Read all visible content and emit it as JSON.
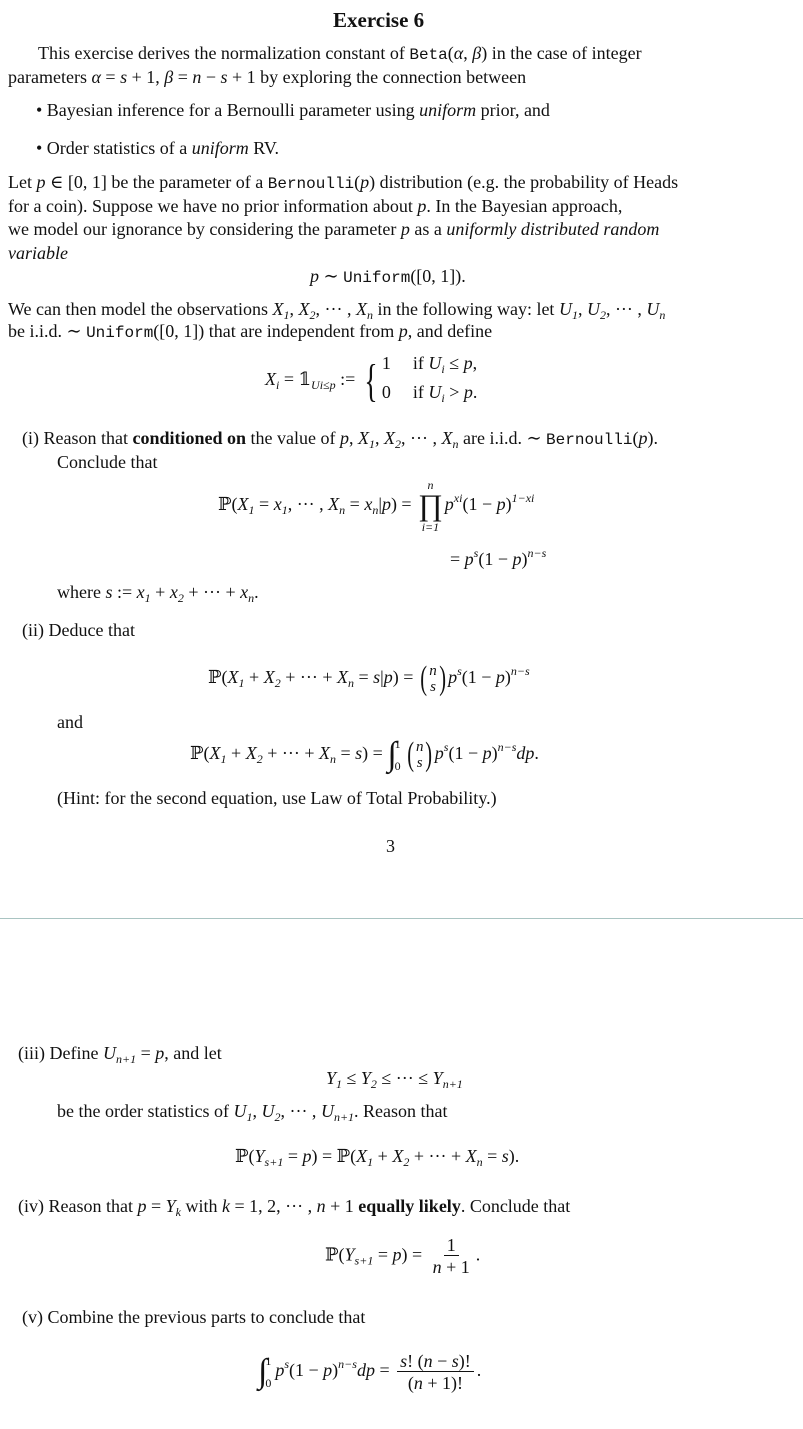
{
  "title": [
    [
      "b",
      "Exercise 6"
    ]
  ],
  "intro1": [
    [
      "t",
      "This exercise derives the normalization constant of "
    ],
    [
      "m",
      "Beta"
    ],
    [
      "t",
      "("
    ],
    [
      "i",
      "α"
    ],
    [
      "t",
      ", "
    ],
    [
      "i",
      "β"
    ],
    [
      "t",
      ") in the case of integer"
    ]
  ],
  "intro2": [
    [
      "t",
      "parameters "
    ],
    [
      "i",
      "α"
    ],
    [
      "t",
      " = "
    ],
    [
      "i",
      "s"
    ],
    [
      "t",
      " + 1, "
    ],
    [
      "i",
      "β"
    ],
    [
      "t",
      " = "
    ],
    [
      "i",
      "n"
    ],
    [
      "t",
      " − "
    ],
    [
      "i",
      "s"
    ],
    [
      "t",
      " + 1 by exploring the connection between"
    ]
  ],
  "bullet1": [
    [
      "t",
      "•  Bayesian inference for a Bernoulli parameter using "
    ],
    [
      "i",
      "uniform"
    ],
    [
      "t",
      " prior, and"
    ]
  ],
  "bullet2": [
    [
      "t",
      "•  Order statistics of a "
    ],
    [
      "i",
      "uniform"
    ],
    [
      "t",
      " RV."
    ]
  ],
  "p1": [
    [
      "t",
      "Let "
    ],
    [
      "i",
      "p"
    ],
    [
      "t",
      " ∈ [0, 1] be the parameter of a "
    ],
    [
      "m",
      "Bernoulli"
    ],
    [
      "t",
      "("
    ],
    [
      "i",
      "p"
    ],
    [
      "t",
      ") distribution (e.g. the probability of Heads"
    ]
  ],
  "p2": [
    [
      "t",
      "for a coin).  Suppose we have no prior information about "
    ],
    [
      "i",
      "p"
    ],
    [
      "t",
      ".  In the Bayesian approach,"
    ]
  ],
  "p3": [
    [
      "t",
      "we model our ignorance by considering the parameter "
    ],
    [
      "i",
      "p"
    ],
    [
      "t",
      " as a "
    ],
    [
      "i",
      "uniformly distributed random"
    ]
  ],
  "p4": [
    [
      "i",
      "variable"
    ]
  ],
  "eq_prior": [
    [
      "i",
      "p"
    ],
    [
      "t",
      " ∼ "
    ],
    [
      "m",
      "Uniform"
    ],
    [
      "t",
      "([0, 1])."
    ]
  ],
  "p5": [
    [
      "t",
      "We can then model the observations "
    ],
    [
      "i",
      "X"
    ],
    [
      "sub",
      "1"
    ],
    [
      "t",
      ", "
    ],
    [
      "i",
      "X"
    ],
    [
      "sub",
      "2"
    ],
    [
      "t",
      ", ··· , "
    ],
    [
      "i",
      "X"
    ],
    [
      "sub",
      "n"
    ],
    [
      "t",
      " in the following way: let "
    ],
    [
      "i",
      "U"
    ],
    [
      "sub",
      "1"
    ],
    [
      "t",
      ", "
    ],
    [
      "i",
      "U"
    ],
    [
      "sub",
      "2"
    ],
    [
      "t",
      ", ··· , "
    ],
    [
      "i",
      "U"
    ],
    [
      "sub",
      "n"
    ]
  ],
  "p6": [
    [
      "t",
      "be i.i.d. ∼ "
    ],
    [
      "m",
      "Uniform"
    ],
    [
      "t",
      "([0, 1]) that are independent from "
    ],
    [
      "i",
      "p"
    ],
    [
      "t",
      ", and define"
    ]
  ],
  "eq_def": [
    [
      "i",
      "X"
    ],
    [
      "sub",
      "i"
    ],
    [
      "t",
      " = 𝟙"
    ],
    [
      "sub",
      "Ui≤p"
    ],
    [
      "t",
      " := "
    ],
    [
      "cases",
      [
        [
          [
            "t",
            "1"
          ],
          [
            "gap",
            ""
          ],
          [
            "t",
            "if "
          ],
          [
            "i",
            "U"
          ],
          [
            "sub",
            "i"
          ],
          [
            "t",
            " ≤ "
          ],
          [
            "i",
            "p"
          ],
          [
            "t",
            ","
          ]
        ],
        [
          [
            "t",
            "0"
          ],
          [
            "gap",
            ""
          ],
          [
            "t",
            "if "
          ],
          [
            "i",
            "U"
          ],
          [
            "sub",
            "i"
          ],
          [
            "t",
            " > "
          ],
          [
            "i",
            "p"
          ],
          [
            "t",
            "."
          ]
        ]
      ]
    ]
  ],
  "q1a": [
    [
      "t",
      "(i) Reason that "
    ],
    [
      "b",
      "conditioned on"
    ],
    [
      "t",
      " the value of "
    ],
    [
      "i",
      "p"
    ],
    [
      "t",
      ", "
    ],
    [
      "i",
      "X"
    ],
    [
      "sub",
      "1"
    ],
    [
      "t",
      ", "
    ],
    [
      "i",
      "X"
    ],
    [
      "sub",
      "2"
    ],
    [
      "t",
      ", ··· , "
    ],
    [
      "i",
      "X"
    ],
    [
      "sub",
      "n"
    ],
    [
      "t",
      " are i.i.d. ∼ "
    ],
    [
      "m",
      "Bernoulli"
    ],
    [
      "t",
      "("
    ],
    [
      "i",
      "p"
    ],
    [
      "t",
      ")."
    ]
  ],
  "q1b": [
    [
      "t",
      "Conclude that"
    ]
  ],
  "eq_joint": [
    [
      "t",
      "ℙ("
    ],
    [
      "i",
      "X"
    ],
    [
      "sub",
      "1"
    ],
    [
      "t",
      " = "
    ],
    [
      "i",
      "x"
    ],
    [
      "sub",
      "1"
    ],
    [
      "t",
      ", ··· , "
    ],
    [
      "i",
      "X"
    ],
    [
      "sub",
      "n"
    ],
    [
      "t",
      " = "
    ],
    [
      "i",
      "x"
    ],
    [
      "sub",
      "n"
    ],
    [
      "t",
      "|"
    ],
    [
      "i",
      "p"
    ],
    [
      "t",
      ") = "
    ],
    [
      "op",
      "∏",
      "n",
      "i=1"
    ],
    [
      "i",
      "p"
    ],
    [
      "sup",
      "xi"
    ],
    [
      "t",
      "(1 − "
    ],
    [
      "i",
      "p"
    ],
    [
      "t",
      ")"
    ],
    [
      "sup",
      "1−xi"
    ]
  ],
  "eq_joint2": [
    [
      "t",
      "= "
    ],
    [
      "i",
      "p"
    ],
    [
      "sup",
      "s"
    ],
    [
      "t",
      "(1 − "
    ],
    [
      "i",
      "p"
    ],
    [
      "t",
      ")"
    ],
    [
      "sup",
      "n−s"
    ]
  ],
  "q1c": [
    [
      "t",
      "where "
    ],
    [
      "i",
      "s"
    ],
    [
      "t",
      " := "
    ],
    [
      "i",
      "x"
    ],
    [
      "sub",
      "1"
    ],
    [
      "t",
      " + "
    ],
    [
      "i",
      "x"
    ],
    [
      "sub",
      "2"
    ],
    [
      "t",
      " + ··· + "
    ],
    [
      "i",
      "x"
    ],
    [
      "sub",
      "n"
    ],
    [
      "t",
      "."
    ]
  ],
  "q2a": [
    [
      "t",
      "(ii) Deduce that"
    ]
  ],
  "eq_cond": [
    [
      "t",
      "ℙ("
    ],
    [
      "i",
      "X"
    ],
    [
      "sub",
      "1"
    ],
    [
      "t",
      " + "
    ],
    [
      "i",
      "X"
    ],
    [
      "sub",
      "2"
    ],
    [
      "t",
      " + ··· + "
    ],
    [
      "i",
      "X"
    ],
    [
      "sub",
      "n"
    ],
    [
      "t",
      " = "
    ],
    [
      "i",
      "s"
    ],
    [
      "t",
      "|"
    ],
    [
      "i",
      "p"
    ],
    [
      "t",
      ") = "
    ],
    [
      "binom",
      "n",
      "s"
    ],
    [
      "i",
      "p"
    ],
    [
      "sup",
      "s"
    ],
    [
      "t",
      "(1 − "
    ],
    [
      "i",
      "p"
    ],
    [
      "t",
      ")"
    ],
    [
      "sup",
      "n−s"
    ]
  ],
  "q2b": [
    [
      "t",
      "and"
    ]
  ],
  "eq_total": [
    [
      "t",
      "ℙ("
    ],
    [
      "i",
      "X"
    ],
    [
      "sub",
      "1"
    ],
    [
      "t",
      " + "
    ],
    [
      "i",
      "X"
    ],
    [
      "sub",
      "2"
    ],
    [
      "t",
      " + ··· + "
    ],
    [
      "i",
      "X"
    ],
    [
      "sub",
      "n"
    ],
    [
      "t",
      " = "
    ],
    [
      "i",
      "s"
    ],
    [
      "t",
      ") = "
    ],
    [
      "int",
      "∫",
      "1",
      "0"
    ],
    [
      "binom",
      "n",
      "s"
    ],
    [
      "i",
      "p"
    ],
    [
      "sup",
      "s"
    ],
    [
      "t",
      "(1 − "
    ],
    [
      "i",
      "p"
    ],
    [
      "t",
      ")"
    ],
    [
      "sup",
      "n−s"
    ],
    [
      "i",
      "dp"
    ],
    [
      "t",
      "."
    ]
  ],
  "q2c": [
    [
      "t",
      "(Hint: for the second equation, use Law of Total Probability.)"
    ]
  ],
  "page_number": [
    [
      "t",
      "3"
    ]
  ],
  "q3a": [
    [
      "t",
      "(iii) Define "
    ],
    [
      "i",
      "U"
    ],
    [
      "sub",
      "n+1"
    ],
    [
      "t",
      " = "
    ],
    [
      "i",
      "p"
    ],
    [
      "t",
      ", and let"
    ]
  ],
  "eq_order": [
    [
      "i",
      "Y"
    ],
    [
      "sub",
      "1"
    ],
    [
      "t",
      " ≤ "
    ],
    [
      "i",
      "Y"
    ],
    [
      "sub",
      "2"
    ],
    [
      "t",
      " ≤ ··· ≤ "
    ],
    [
      "i",
      "Y"
    ],
    [
      "sub",
      "n+1"
    ]
  ],
  "q3b": [
    [
      "t",
      "be the order statistics of "
    ],
    [
      "i",
      "U"
    ],
    [
      "sub",
      "1"
    ],
    [
      "t",
      ", "
    ],
    [
      "i",
      "U"
    ],
    [
      "sub",
      "2"
    ],
    [
      "t",
      ", ··· , "
    ],
    [
      "i",
      "U"
    ],
    [
      "sub",
      "n+1"
    ],
    [
      "t",
      ".  Reason that"
    ]
  ],
  "eq_equiv": [
    [
      "t",
      "ℙ("
    ],
    [
      "i",
      "Y"
    ],
    [
      "sub",
      "s+1"
    ],
    [
      "t",
      " = "
    ],
    [
      "i",
      "p"
    ],
    [
      "t",
      ") = ℙ("
    ],
    [
      "i",
      "X"
    ],
    [
      "sub",
      "1"
    ],
    [
      "t",
      " + "
    ],
    [
      "i",
      "X"
    ],
    [
      "sub",
      "2"
    ],
    [
      "t",
      " + ··· + "
    ],
    [
      "i",
      "X"
    ],
    [
      "sub",
      "n"
    ],
    [
      "t",
      " = "
    ],
    [
      "i",
      "s"
    ],
    [
      "t",
      ")."
    ]
  ],
  "q4a": [
    [
      "t",
      "(iv) Reason that "
    ],
    [
      "i",
      "p"
    ],
    [
      "t",
      " = "
    ],
    [
      "i",
      "Y"
    ],
    [
      "sub",
      "k"
    ],
    [
      "t",
      " with "
    ],
    [
      "i",
      "k"
    ],
    [
      "t",
      " = 1, 2, ··· , "
    ],
    [
      "i",
      "n"
    ],
    [
      "t",
      " + 1 "
    ],
    [
      "b",
      "equally likely"
    ],
    [
      "t",
      ". Conclude that"
    ]
  ],
  "eq_uniform": [
    [
      "t",
      "ℙ("
    ],
    [
      "i",
      "Y"
    ],
    [
      "sub",
      "s+1"
    ],
    [
      "t",
      " = "
    ],
    [
      "i",
      "p"
    ],
    [
      "t",
      ") = "
    ],
    [
      "frac",
      [
        [
          "t",
          "1"
        ]
      ],
      [
        [
          "i",
          "n"
        ],
        [
          "t",
          " + 1"
        ]
      ]
    ],
    [
      "t",
      "."
    ]
  ],
  "q5a": [
    [
      "t",
      "(v) Combine the previous parts to conclude that"
    ]
  ],
  "eq_final": [
    [
      "int",
      "∫",
      "1",
      "0"
    ],
    [
      "i",
      "p"
    ],
    [
      "sup",
      "s"
    ],
    [
      "t",
      "(1 − "
    ],
    [
      "i",
      "p"
    ],
    [
      "t",
      ")"
    ],
    [
      "sup",
      "n−s"
    ],
    [
      "i",
      "dp"
    ],
    [
      "t",
      " = "
    ],
    [
      "frac",
      [
        [
          "i",
          "s"
        ],
        [
          "t",
          "! ("
        ],
        [
          "i",
          "n"
        ],
        [
          "t",
          " − "
        ],
        [
          "i",
          "s"
        ],
        [
          "t",
          ")!"
        ]
      ],
      [
        [
          "t",
          "("
        ],
        [
          "i",
          "n"
        ],
        [
          "t",
          " + 1)!"
        ]
      ]
    ],
    [
      "t",
      "."
    ]
  ]
}
